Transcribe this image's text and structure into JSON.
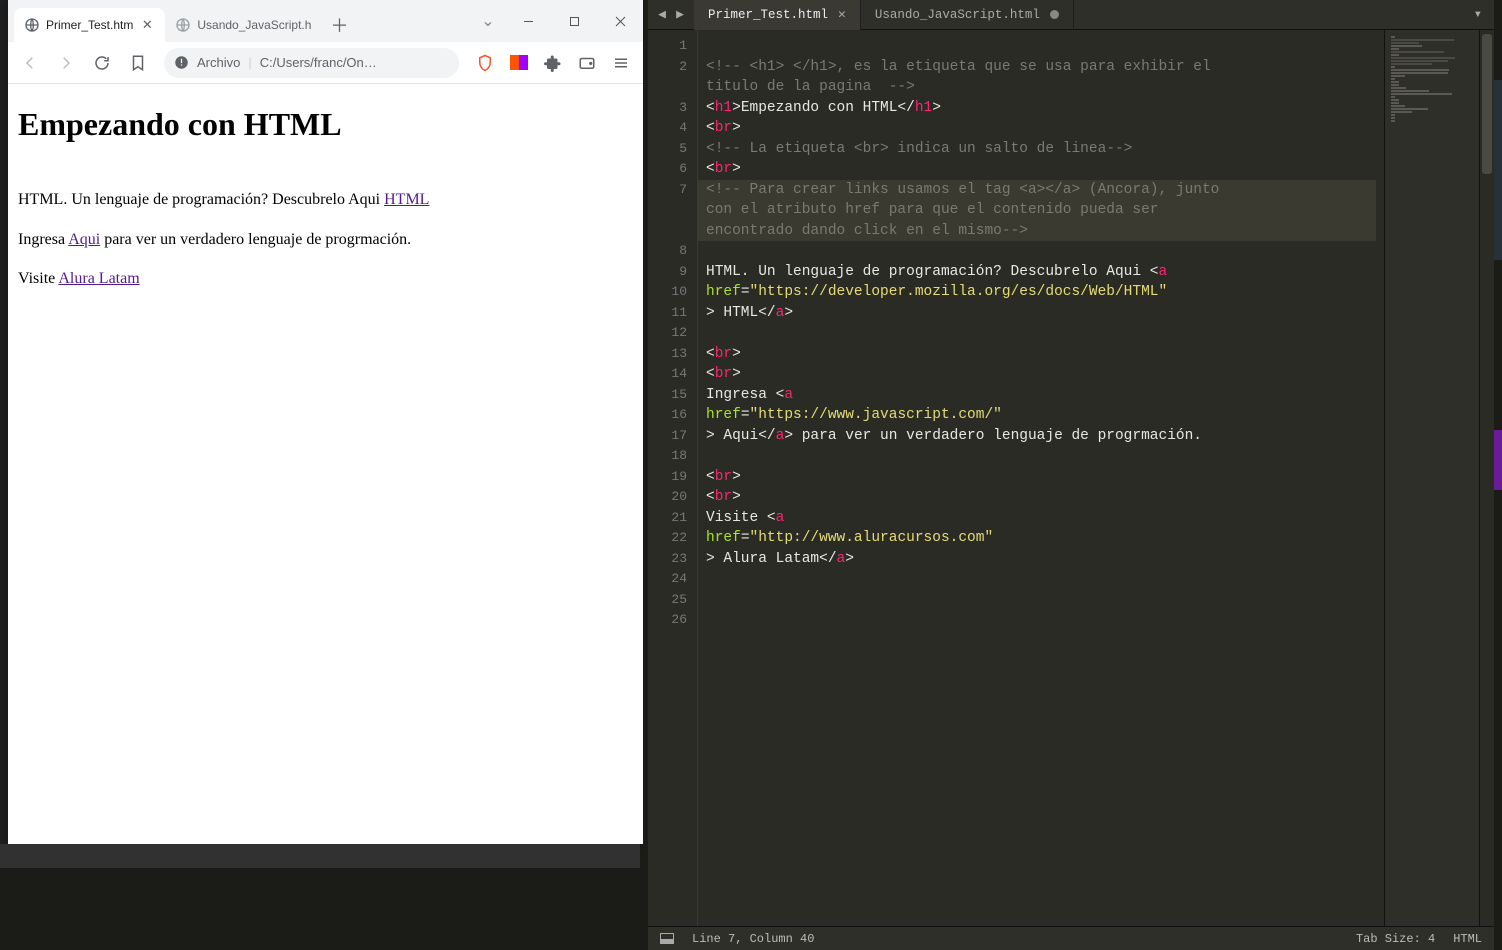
{
  "browser": {
    "tabs": [
      {
        "title": "Primer_Test.htm",
        "active": true
      },
      {
        "title": "Usando_JavaScript.h",
        "active": false
      }
    ],
    "address": {
      "scheme_label": "Archivo",
      "url_display": "C:/Users/franc/On…"
    },
    "page": {
      "h1": "Empezando con HTML",
      "p1_pre": "HTML. Un lenguaje de programación? Descubrelo Aqui ",
      "p1_link": "HTML",
      "p2_pre": "Ingresa ",
      "p2_link": "Aqui",
      "p2_post": " para ver un verdadero lenguaje de progrmación.",
      "p3_pre": "Visite ",
      "p3_link": "Alura Latam"
    }
  },
  "editor": {
    "tabs": [
      {
        "title": "Primer_Test.html",
        "active": true,
        "dirty": false
      },
      {
        "title": "Usando_JavaScript.html",
        "active": false,
        "dirty": true
      }
    ],
    "status": {
      "cursor": "Line 7, Column 40",
      "tabsize": "Tab Size: 4",
      "syntax": "HTML"
    },
    "lines": [
      {
        "n": 1,
        "seg": []
      },
      {
        "n": 2,
        "seg": [
          {
            "c": "tok-comment",
            "t": "<!-- <h1> </h1>, es la etiqueta que se usa para exhibir el "
          }
        ]
      },
      {
        "n": 2,
        "wrap": true,
        "seg": [
          {
            "c": "tok-comment",
            "t": "titulo de la pagina  -->"
          }
        ]
      },
      {
        "n": 3,
        "seg": [
          {
            "c": "tok-punct",
            "t": "<"
          },
          {
            "c": "tok-tag",
            "t": "h1"
          },
          {
            "c": "tok-punct",
            "t": ">"
          },
          {
            "c": "tok-text",
            "t": "Empezando con HTML"
          },
          {
            "c": "tok-punct",
            "t": "</"
          },
          {
            "c": "tok-tag",
            "t": "h1"
          },
          {
            "c": "tok-punct",
            "t": ">"
          }
        ]
      },
      {
        "n": 4,
        "seg": [
          {
            "c": "tok-punct",
            "t": "<"
          },
          {
            "c": "tok-tag",
            "t": "br"
          },
          {
            "c": "tok-punct",
            "t": ">"
          }
        ]
      },
      {
        "n": 5,
        "seg": [
          {
            "c": "tok-comment",
            "t": "<!-- La etiqueta <br> indica un salto de linea-->"
          }
        ]
      },
      {
        "n": 6,
        "seg": [
          {
            "c": "tok-punct",
            "t": "<"
          },
          {
            "c": "tok-tag",
            "t": "br"
          },
          {
            "c": "tok-punct",
            "t": ">"
          }
        ]
      },
      {
        "n": 7,
        "hl": true,
        "seg": [
          {
            "c": "tok-comment",
            "t": "<!-- Para crear links usamos el tag <a></a> (Ancora), junto "
          }
        ]
      },
      {
        "n": 7,
        "wrap": true,
        "hl": true,
        "seg": [
          {
            "c": "tok-comment",
            "t": "con el atributo href para que el contenido pueda ser "
          }
        ]
      },
      {
        "n": 7,
        "wrap": true,
        "hl": true,
        "seg": [
          {
            "c": "tok-comment",
            "t": "encontrado dando click en el mismo-->"
          }
        ]
      },
      {
        "n": 8,
        "seg": []
      },
      {
        "n": 9,
        "seg": [
          {
            "c": "tok-text",
            "t": "HTML. Un lenguaje de programación? Descubrelo Aqui "
          },
          {
            "c": "tok-punct",
            "t": "<"
          },
          {
            "c": "tok-tag",
            "t": "a"
          },
          {
            "c": "tok-text",
            "t": " "
          }
        ]
      },
      {
        "n": 10,
        "seg": [
          {
            "c": "tok-attr",
            "t": "href"
          },
          {
            "c": "tok-punct",
            "t": "="
          },
          {
            "c": "tok-str",
            "t": "\"https://developer.mozilla.org/es/docs/Web/HTML\""
          }
        ]
      },
      {
        "n": 11,
        "seg": [
          {
            "c": "tok-punct",
            "t": "> "
          },
          {
            "c": "tok-text",
            "t": "HTML"
          },
          {
            "c": "tok-punct",
            "t": "</"
          },
          {
            "c": "tok-tag",
            "t": "a"
          },
          {
            "c": "tok-punct",
            "t": ">"
          }
        ]
      },
      {
        "n": 12,
        "seg": []
      },
      {
        "n": 13,
        "seg": [
          {
            "c": "tok-punct",
            "t": "<"
          },
          {
            "c": "tok-tag",
            "t": "br"
          },
          {
            "c": "tok-punct",
            "t": ">"
          }
        ]
      },
      {
        "n": 14,
        "seg": [
          {
            "c": "tok-punct",
            "t": "<"
          },
          {
            "c": "tok-tag",
            "t": "br"
          },
          {
            "c": "tok-punct",
            "t": ">"
          }
        ]
      },
      {
        "n": 15,
        "seg": [
          {
            "c": "tok-text",
            "t": "Ingresa "
          },
          {
            "c": "tok-punct",
            "t": "<"
          },
          {
            "c": "tok-tag",
            "t": "a"
          },
          {
            "c": "tok-text",
            "t": " "
          }
        ]
      },
      {
        "n": 16,
        "seg": [
          {
            "c": "tok-attr",
            "t": "href"
          },
          {
            "c": "tok-punct",
            "t": "="
          },
          {
            "c": "tok-str",
            "t": "\"https://www.javascript.com/\""
          }
        ]
      },
      {
        "n": 17,
        "seg": [
          {
            "c": "tok-punct",
            "t": "> "
          },
          {
            "c": "tok-text",
            "t": "Aqui"
          },
          {
            "c": "tok-punct",
            "t": "</"
          },
          {
            "c": "tok-tag",
            "t": "a"
          },
          {
            "c": "tok-punct",
            "t": ">"
          },
          {
            "c": "tok-text",
            "t": " para ver un verdadero lenguaje de progrmación."
          }
        ]
      },
      {
        "n": 18,
        "seg": []
      },
      {
        "n": 19,
        "seg": [
          {
            "c": "tok-punct",
            "t": "<"
          },
          {
            "c": "tok-tag",
            "t": "br"
          },
          {
            "c": "tok-punct",
            "t": ">"
          }
        ]
      },
      {
        "n": 20,
        "seg": [
          {
            "c": "tok-punct",
            "t": "<"
          },
          {
            "c": "tok-tag",
            "t": "br"
          },
          {
            "c": "tok-punct",
            "t": ">"
          }
        ]
      },
      {
        "n": 21,
        "seg": [
          {
            "c": "tok-text",
            "t": "Visite "
          },
          {
            "c": "tok-punct",
            "t": "<"
          },
          {
            "c": "tok-tag",
            "t": "a"
          },
          {
            "c": "tok-text",
            "t": " "
          }
        ]
      },
      {
        "n": 22,
        "seg": [
          {
            "c": "tok-attr",
            "t": "href"
          },
          {
            "c": "tok-punct",
            "t": "="
          },
          {
            "c": "tok-str",
            "t": "\"http://www.aluracursos.com\""
          }
        ]
      },
      {
        "n": 23,
        "seg": [
          {
            "c": "tok-punct",
            "t": "> "
          },
          {
            "c": "tok-text",
            "t": "Alura Latam"
          },
          {
            "c": "tok-punct",
            "t": "</"
          },
          {
            "c": "tok-tag",
            "t": "a"
          },
          {
            "c": "tok-punct",
            "t": ">"
          }
        ]
      },
      {
        "n": 24,
        "seg": []
      },
      {
        "n": 25,
        "seg": []
      },
      {
        "n": 26,
        "seg": []
      }
    ]
  }
}
